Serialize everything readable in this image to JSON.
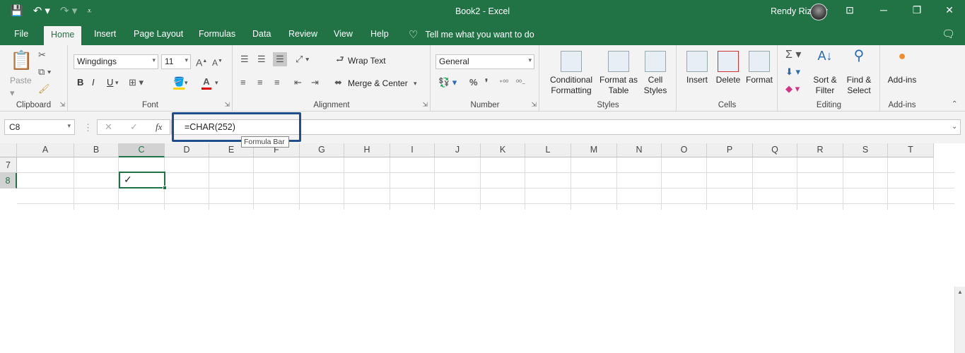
{
  "window": {
    "title": "Book2 - Excel",
    "user": "Rendy Rizaldy",
    "qat_icons": [
      "save-icon",
      "undo-icon",
      "redo-icon",
      "customize-icon"
    ],
    "controls": [
      "─",
      "▢",
      "✕"
    ]
  },
  "tabs": [
    "File",
    "Home",
    "Insert",
    "Page Layout",
    "Formulas",
    "Data",
    "Review",
    "View",
    "Help"
  ],
  "active_tab": "Home",
  "tell_me": "Tell me what you want to do",
  "ribbon": {
    "clipboard": {
      "label": "Clipboard",
      "paste": "Paste"
    },
    "font": {
      "label": "Font",
      "name": "Wingdings",
      "size": "11",
      "bold": "B",
      "italic": "I",
      "underline": "U"
    },
    "alignment": {
      "label": "Alignment",
      "wrap": "Wrap Text",
      "merge": "Merge & Center"
    },
    "number": {
      "label": "Number",
      "format": "General"
    },
    "styles": {
      "label": "Styles",
      "conditional": [
        "Conditional",
        "Formatting"
      ],
      "format_table": [
        "Format as",
        "Table"
      ],
      "cell_styles": [
        "Cell",
        "Styles"
      ]
    },
    "cells": {
      "label": "Cells",
      "insert": "Insert",
      "delete": "Delete",
      "format": "Format"
    },
    "editing": {
      "label": "Editing",
      "sort": [
        "Sort &",
        "Filter"
      ],
      "find": [
        "Find &",
        "Select"
      ]
    },
    "addins": {
      "label": "Add-ins",
      "button": "Add-ins"
    }
  },
  "formula_bar": {
    "name_box": "C8",
    "fx": "fx",
    "formula": "=CHAR(252)",
    "tooltip": "Formula Bar"
  },
  "sheet": {
    "columns": [
      "A",
      "B",
      "C",
      "D",
      "E",
      "F",
      "G",
      "H",
      "I",
      "J",
      "K",
      "L",
      "M",
      "N",
      "O",
      "P",
      "Q",
      "R",
      "S",
      "T"
    ],
    "rows": [
      "7",
      "8"
    ],
    "active_cell": "C8",
    "active_value": "✓"
  },
  "colors": {
    "accent": "#217346",
    "highlight_box": "#1f4e8c"
  }
}
